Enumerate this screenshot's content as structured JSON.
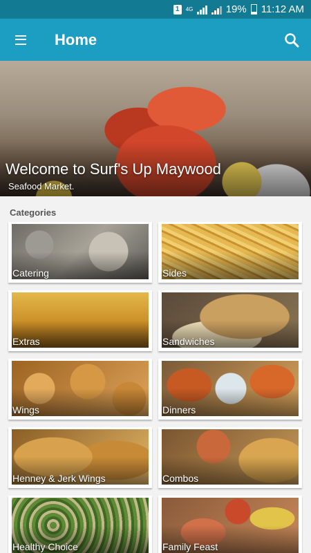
{
  "status_bar": {
    "sim_slot": "1",
    "network": "4G",
    "battery": "19%",
    "time": "11:12 AM"
  },
  "app_bar": {
    "title": "Home",
    "menu_icon": "hamburger-menu-icon",
    "search_icon": "search-icon"
  },
  "hero": {
    "title": "Welcome to Surf's Up Maywood",
    "subtitle": "Seafood Market."
  },
  "categories": {
    "heading": "Categories",
    "items": [
      {
        "label": "Catering"
      },
      {
        "label": "Sides"
      },
      {
        "label": "Extras"
      },
      {
        "label": "Sandwiches"
      },
      {
        "label": "Wings"
      },
      {
        "label": "Dinners"
      },
      {
        "label": "Henney & Jerk Wings"
      },
      {
        "label": "Combos"
      },
      {
        "label": "Healthy Choice"
      },
      {
        "label": "Family Feast"
      }
    ]
  },
  "colors": {
    "status_bar": "#137a93",
    "app_bar": "#1b9ec2",
    "background": "#f2f2f2"
  }
}
